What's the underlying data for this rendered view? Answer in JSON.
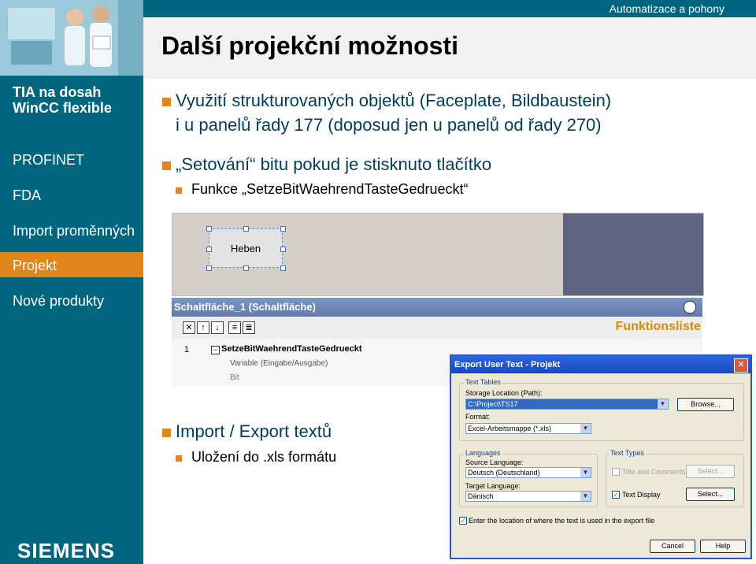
{
  "header": {
    "top_right": "Automatizace a pohony",
    "title": "Další projekční možnosti"
  },
  "sidebar": {
    "items": [
      {
        "label": "TIA na dosah"
      },
      {
        "label": "WinCC flexible"
      },
      {
        "label": "PROFINET"
      },
      {
        "label": "FDA"
      },
      {
        "label": "Import proměnných"
      },
      {
        "label": "Projekt"
      },
      {
        "label": "Nové produkty"
      }
    ],
    "logo": "SIEMENS"
  },
  "content": {
    "bullet1_line1": "Využití strukturovaných objektů (Faceplate, Bildbaustein)",
    "bullet1_line2": "i u panelů řady 177 (doposud jen u panelů od řady 270)",
    "bullet2": "„Setování“ bitu pokud je stisknuto tlačítko",
    "bullet2_sub": "Funkce „SetzeBitWaehrendTasteGedrueckt“",
    "bullet3": "Import / Export textů",
    "bullet3_sub": "Uložení do .xls formátu"
  },
  "screenshot1": {
    "button_label": "Heben"
  },
  "screenshot2": {
    "title": "Schaltfläche_1 (Schaltfläche)",
    "funktionsliste": "Funktionsliste",
    "row_number": "1",
    "function_name": "SetzeBitWaehrendTasteGedrueckt",
    "param1": "Variable (Eingabe/Ausgabe)",
    "param2": "Bit"
  },
  "dialog": {
    "title": "Export User Text - Projekt",
    "close": "✕",
    "text_tables_label": "Text Tables",
    "storage_label": "Storage Location (Path):",
    "storage_value": "C:\\Project\\TS17",
    "browse_label": "Browse...",
    "format_label": "Format:",
    "format_value": "Excel-Arbeitsmappe (*.xls)",
    "languages_label": "Languages",
    "source_lang_label": "Source Language:",
    "source_lang_value": "Deutsch (Deutschland)",
    "target_lang_label": "Target Language:",
    "target_lang_value": "Dänisch",
    "text_types_label": "Text Types",
    "title_comments_label": "Title and Comments",
    "text_display_label": "Text Display",
    "select1_label": "Select...",
    "select2_label": "Select...",
    "enter_location_label": "Enter the location of where the text is used in the export file",
    "cancel_label": "Cancel",
    "help_label": "Help"
  }
}
